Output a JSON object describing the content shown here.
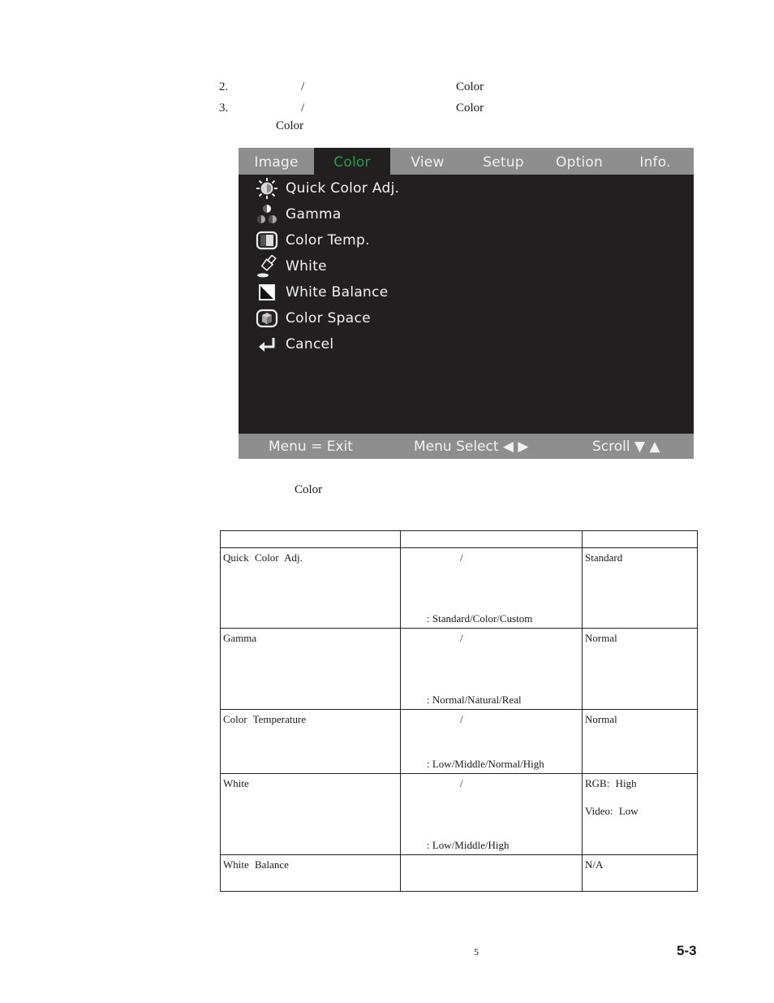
{
  "instructions": [
    {
      "number": "2.",
      "slash": "/",
      "term": "Color"
    },
    {
      "number": "3.",
      "slash": "/",
      "term": "Color"
    }
  ],
  "instruction_continuation": "Color",
  "osd_menu": {
    "tabs": [
      {
        "label": "Image",
        "active": false
      },
      {
        "label": "Color",
        "active": true
      },
      {
        "label": "View",
        "active": false
      },
      {
        "label": "Setup",
        "active": false
      },
      {
        "label": "Option",
        "active": false
      },
      {
        "label": "Info.",
        "active": false
      }
    ],
    "items": [
      {
        "label": "Quick Color Adj.",
        "icon": "sun-cube-icon"
      },
      {
        "label": "Gamma",
        "icon": "gamma-circles-icon"
      },
      {
        "label": "Color Temp.",
        "icon": "monitor-icon"
      },
      {
        "label": "White",
        "icon": "brush-icon"
      },
      {
        "label": "White Balance",
        "icon": "diagonal-square-icon"
      },
      {
        "label": "Color Space",
        "icon": "cube-screen-icon"
      },
      {
        "label": "Cancel",
        "icon": "return-arrow-icon"
      }
    ],
    "footer": {
      "exit": "Menu = Exit",
      "select": "Menu Select ◀ ▶",
      "scroll": "Scroll ▼ ▲"
    },
    "colors": {
      "background": "#221f20",
      "bar": "#8f8e8e",
      "active_tab_text": "#1fa04a",
      "text": "#f2f2f2"
    }
  },
  "caption": "Color",
  "table": {
    "header": [
      "",
      "",
      ""
    ],
    "rows": [
      {
        "name": "Quick Color Adj.",
        "slash": "/",
        "options": ":  Standard/Color/Custom",
        "default": "Standard",
        "default2": ""
      },
      {
        "name": "Gamma",
        "slash": "/",
        "options": ":  Normal/Natural/Real",
        "default": "Normal",
        "default2": ""
      },
      {
        "name": "Color Temperature",
        "slash": "/",
        "options": ":  Low/Middle/Normal/High",
        "default": "Normal",
        "default2": ""
      },
      {
        "name": "White",
        "slash": "/",
        "options": ":  Low/Middle/High",
        "default": "RGB:  High",
        "default2": "Video:  Low"
      },
      {
        "name": "White Balance",
        "slash": "",
        "options": "",
        "default": "N/A",
        "default2": ""
      }
    ]
  },
  "footer": {
    "page_center": "5",
    "page_number": "5-3"
  }
}
